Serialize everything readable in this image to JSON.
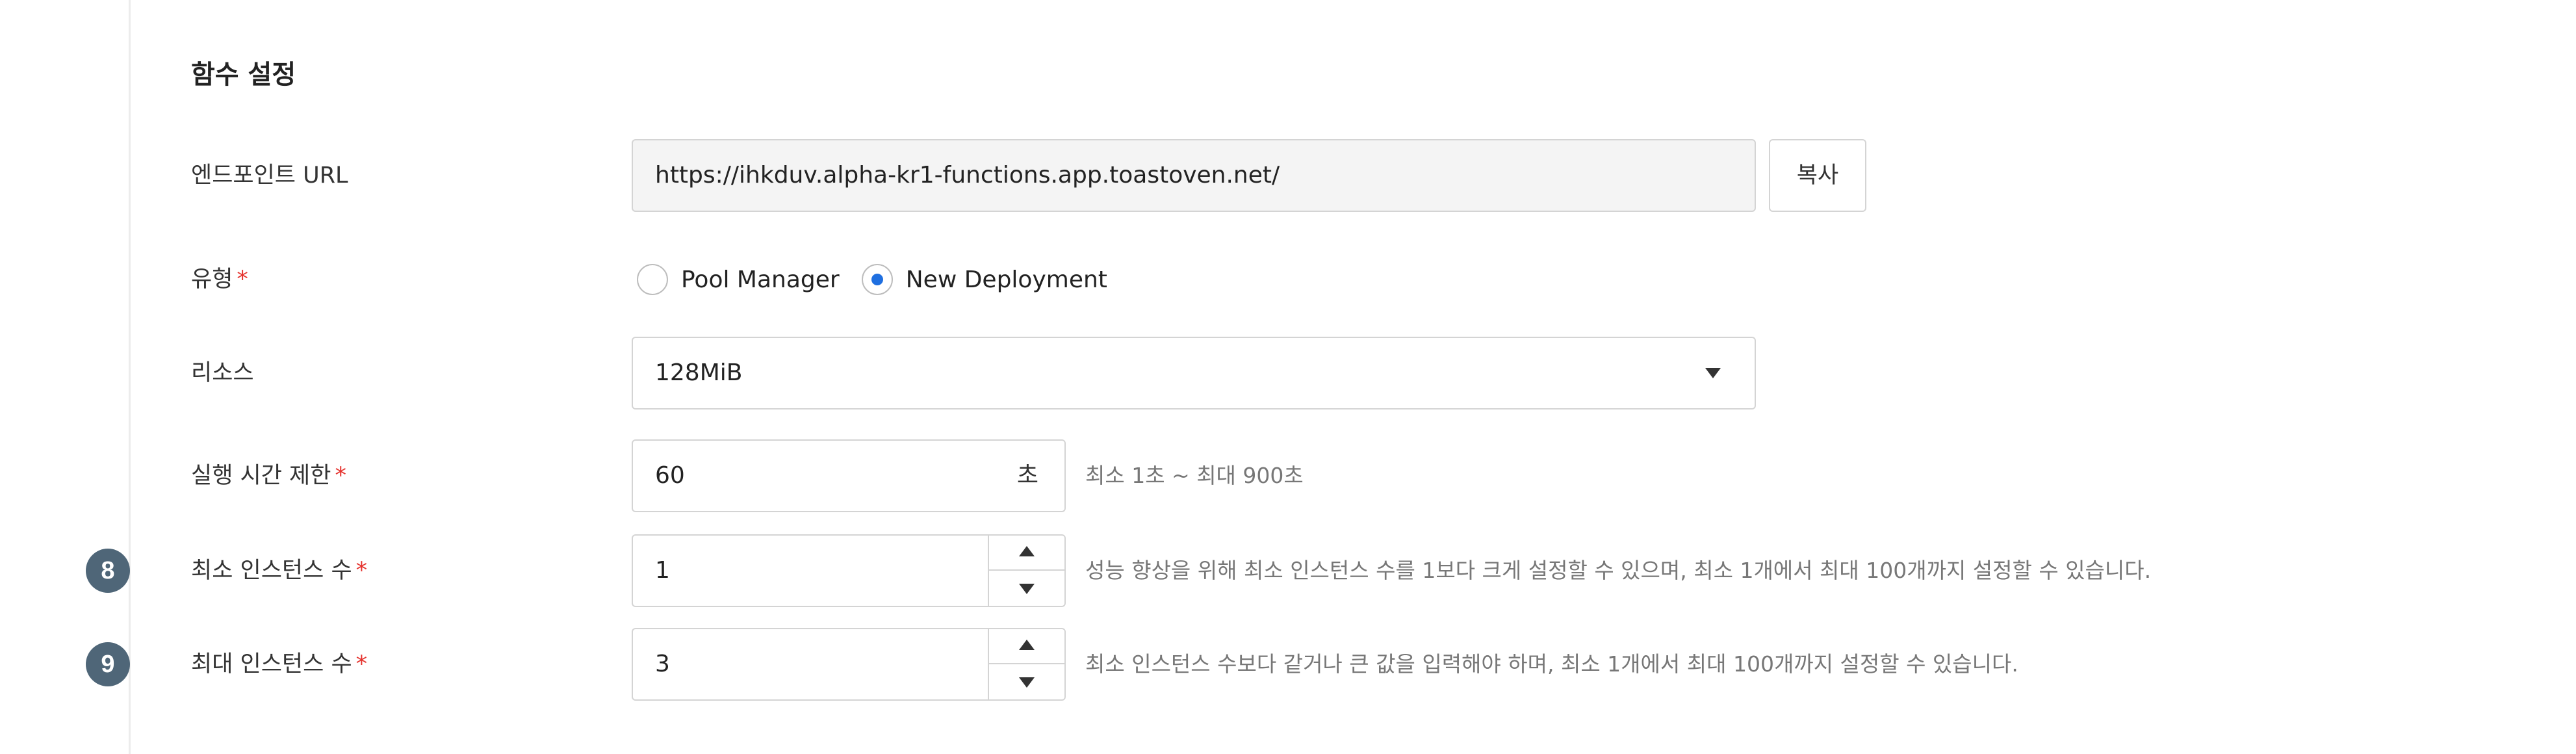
{
  "section_title": "함수 설정",
  "endpoint": {
    "label": "엔드포인트 URL",
    "value": "https://ihkduv.alpha-kr1-functions.app.toastoven.net/",
    "copy_label": "복사"
  },
  "type": {
    "label": "유형",
    "required_mark": "*",
    "options": [
      {
        "label": "Pool Manager",
        "checked": false
      },
      {
        "label": "New Deployment",
        "checked": true
      }
    ]
  },
  "resource": {
    "label": "리소스",
    "selected": "128MiB"
  },
  "timeout": {
    "label": "실행 시간 제한",
    "required_mark": "*",
    "value": "60",
    "unit": "초",
    "help": "최소 1초 ~ 최대 900초"
  },
  "min_instances": {
    "badge": "8",
    "label": "최소 인스턴스 수",
    "required_mark": "*",
    "value": "1",
    "help": "성능 향상을 위해 최소 인스턴스 수를 1보다 크게 설정할 수 있으며, 최소 1개에서 최대 100개까지 설정할 수 있습니다."
  },
  "max_instances": {
    "badge": "9",
    "label": "최대 인스턴스 수",
    "required_mark": "*",
    "value": "3",
    "help": "최소 인스턴스 수보다 같거나 큰 값을 입력해야 하며, 최소 1개에서 최대 100개까지 설정할 수 있습니다."
  },
  "colors": {
    "accent": "#1f6fe0",
    "required": "#e5322d",
    "badge": "#4f6678"
  }
}
